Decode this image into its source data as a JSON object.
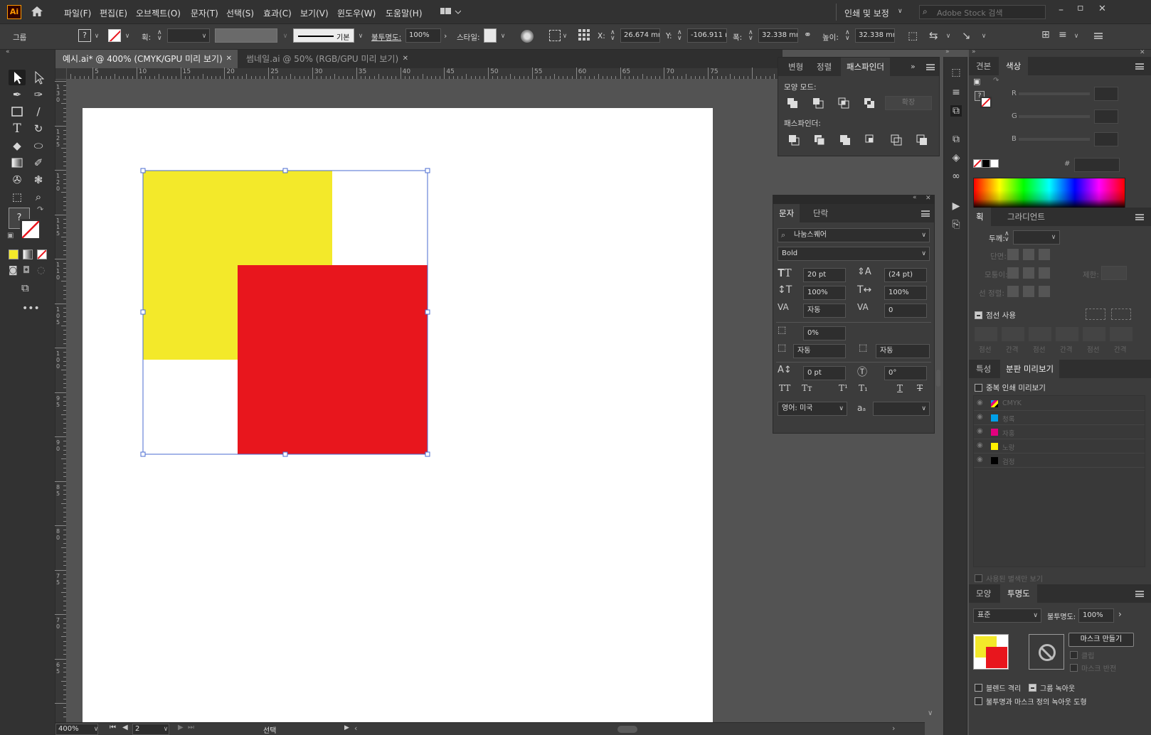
{
  "menubar": {
    "app_logo": "Ai",
    "items": [
      "파일(F)",
      "편집(E)",
      "오브젝트(O)",
      "문자(T)",
      "선택(S)",
      "효과(C)",
      "보기(V)",
      "윈도우(W)",
      "도움말(H)"
    ],
    "workspace": "인쇄 및 보정",
    "stock_placeholder": "Adobe Stock 검색"
  },
  "control_bar": {
    "selection_type": "그룹",
    "stroke_label": "획:",
    "stroke_profile": "기본",
    "opacity_label": "불투명도:",
    "opacity_value": "100%",
    "style_label": "스타일:",
    "x_label": "X:",
    "x_value": "26.674 mm",
    "y_label": "Y:",
    "y_value": "-106.911 m",
    "w_label": "폭:",
    "w_value": "32.338 mm",
    "h_label": "높이:",
    "h_value": "32.338 mm"
  },
  "document_tabs": [
    {
      "label": "예시.ai* @ 400% (CMYK/GPU 미리 보기)",
      "active": true
    },
    {
      "label": "썸네일.ai @ 50% (RGB/GPU 미리 보기)",
      "active": false
    }
  ],
  "ruler_h": [
    "5",
    "10",
    "15",
    "20",
    "25",
    "30",
    "35",
    "40",
    "45",
    "50",
    "55",
    "60",
    "65",
    "70",
    "75"
  ],
  "ruler_v": [
    "130",
    "125",
    "120",
    "115",
    "110",
    "105",
    "100",
    "95",
    "90",
    "85",
    "80",
    "75",
    "70",
    "65"
  ],
  "artwork": {
    "yellow": "#f3e92a",
    "red": "#e8161d",
    "selection": "#4a6bd1"
  },
  "status": {
    "zoom": "400%",
    "page": "2",
    "tool": "선택"
  },
  "pathfinder_panel": {
    "tabs": [
      "변형",
      "정렬",
      "패스파인더"
    ],
    "shape_modes_label": "모양 모드:",
    "expand_button": "확장",
    "pathfinders_label": "패스파인더:"
  },
  "character_panel": {
    "tabs": [
      "문자",
      "단락"
    ],
    "font_family": "나눔스퀘어",
    "font_style": "Bold",
    "font_size": "20 pt",
    "leading": "(24 pt)",
    "vertical_scale": "100%",
    "horizontal_scale": "100%",
    "kerning": "자동",
    "tracking": "0",
    "tsume": "0%",
    "aki_left": "자동",
    "aki_right": "자동",
    "baseline_shift": "0 pt",
    "rotation": "0°",
    "language": "영어: 미국"
  },
  "color_panel": {
    "tabs": [
      "견본",
      "색상"
    ],
    "channels": [
      "R",
      "G",
      "B"
    ],
    "hex_label": "#"
  },
  "stroke_panel": {
    "tabs": [
      "획",
      "그라디언트"
    ],
    "weight_label": "두께:",
    "cap_label": "단면:",
    "corner_label": "모퉁이:",
    "limit_label": "제한:",
    "align_label": "선 정렬:",
    "dashed_label": "점선 사용",
    "dash_labels": [
      "점선",
      "간격",
      "점선",
      "간격",
      "점선",
      "간격"
    ]
  },
  "separations_panel": {
    "tabs": [
      "특성",
      "분판 미리보기"
    ],
    "overprint_label": "중복 인쇄 미리보기",
    "plates": [
      {
        "name": "CMYK",
        "color": "cmyk"
      },
      {
        "name": "청록",
        "color": "#00a0e9"
      },
      {
        "name": "자홍",
        "color": "#e4007f"
      },
      {
        "name": "노랑",
        "color": "#fff100"
      },
      {
        "name": "검정",
        "color": "#000000"
      }
    ],
    "used_only_label": "사용된 별색만 보기"
  },
  "transparency_panel": {
    "tabs": [
      "모양",
      "투명도"
    ],
    "blend_mode": "표준",
    "opacity_label": "불투명도:",
    "opacity_value": "100%",
    "make_mask": "마스크 만들기",
    "clip": "클립",
    "invert_mask": "마스크 반전",
    "isolate_blending": "블렌드 격리",
    "knockout_group": "그룹 녹아웃",
    "opacity_mask_define": "불투명과 마스크 정의 녹아웃 도형"
  }
}
